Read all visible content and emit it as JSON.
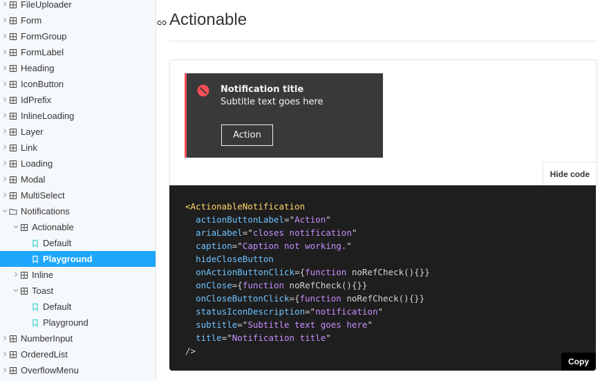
{
  "sidebar": {
    "items": [
      {
        "label": "FileUploader",
        "depth": 0,
        "type": "component",
        "caret": "right"
      },
      {
        "label": "Form",
        "depth": 0,
        "type": "component",
        "caret": "right"
      },
      {
        "label": "FormGroup",
        "depth": 0,
        "type": "component",
        "caret": "right"
      },
      {
        "label": "FormLabel",
        "depth": 0,
        "type": "component",
        "caret": "right"
      },
      {
        "label": "Heading",
        "depth": 0,
        "type": "component",
        "caret": "right"
      },
      {
        "label": "IconButton",
        "depth": 0,
        "type": "component",
        "caret": "right"
      },
      {
        "label": "IdPrefix",
        "depth": 0,
        "type": "component",
        "caret": "right"
      },
      {
        "label": "InlineLoading",
        "depth": 0,
        "type": "component",
        "caret": "right"
      },
      {
        "label": "Layer",
        "depth": 0,
        "type": "component",
        "caret": "right"
      },
      {
        "label": "Link",
        "depth": 0,
        "type": "component",
        "caret": "right"
      },
      {
        "label": "Loading",
        "depth": 0,
        "type": "component",
        "caret": "right"
      },
      {
        "label": "Modal",
        "depth": 0,
        "type": "component",
        "caret": "right"
      },
      {
        "label": "MultiSelect",
        "depth": 0,
        "type": "component",
        "caret": "right"
      },
      {
        "label": "Notifications",
        "depth": 0,
        "type": "folder",
        "caret": "down"
      },
      {
        "label": "Actionable",
        "depth": 1,
        "type": "component",
        "caret": "down"
      },
      {
        "label": "Default",
        "depth": 2,
        "type": "story",
        "caret": ""
      },
      {
        "label": "Playground",
        "depth": 2,
        "type": "story",
        "caret": "",
        "selected": true
      },
      {
        "label": "Inline",
        "depth": 1,
        "type": "component",
        "caret": "right"
      },
      {
        "label": "Toast",
        "depth": 1,
        "type": "component",
        "caret": "down"
      },
      {
        "label": "Default",
        "depth": 2,
        "type": "story",
        "caret": ""
      },
      {
        "label": "Playground",
        "depth": 2,
        "type": "story",
        "caret": ""
      },
      {
        "label": "NumberInput",
        "depth": 0,
        "type": "component",
        "caret": "right"
      },
      {
        "label": "OrderedList",
        "depth": 0,
        "type": "component",
        "caret": "right"
      },
      {
        "label": "OverflowMenu",
        "depth": 0,
        "type": "component",
        "caret": "right"
      }
    ],
    "icon_names": {
      "component": "component-grid-icon",
      "folder": "folder-icon",
      "story": "bookmark-icon"
    }
  },
  "main": {
    "title": "Actionable",
    "anchor_icon": "link-icon",
    "notification": {
      "title": "Notification title",
      "subtitle": "Subtitle text goes here",
      "action_label": "Action",
      "status_icon": "error-filled-icon"
    },
    "hide_code_label": "Hide code",
    "copy_label": "Copy",
    "code_lines": [
      [
        [
          "tag",
          "<ActionableNotification"
        ]
      ],
      [
        [
          "plain",
          "  "
        ],
        [
          "attr",
          "actionButtonLabel"
        ],
        [
          "plain",
          "=\""
        ],
        [
          "str",
          "Action"
        ],
        [
          "plain",
          "\""
        ]
      ],
      [
        [
          "plain",
          "  "
        ],
        [
          "attr",
          "ariaLabel"
        ],
        [
          "plain",
          "=\""
        ],
        [
          "str",
          "closes notification"
        ],
        [
          "plain",
          "\""
        ]
      ],
      [
        [
          "plain",
          "  "
        ],
        [
          "attr",
          "caption"
        ],
        [
          "plain",
          "=\""
        ],
        [
          "str",
          "Caption not working."
        ],
        [
          "plain",
          "\""
        ]
      ],
      [
        [
          "plain",
          "  "
        ],
        [
          "attr",
          "hideCloseButton"
        ]
      ],
      [
        [
          "plain",
          "  "
        ],
        [
          "attr",
          "onActionButtonClick"
        ],
        [
          "plain",
          "={"
        ],
        [
          "kw",
          "function"
        ],
        [
          "plain",
          " noRefCheck(){}}"
        ]
      ],
      [
        [
          "plain",
          "  "
        ],
        [
          "attr",
          "onClose"
        ],
        [
          "plain",
          "={"
        ],
        [
          "kw",
          "function"
        ],
        [
          "plain",
          " noRefCheck(){}}"
        ]
      ],
      [
        [
          "plain",
          "  "
        ],
        [
          "attr",
          "onCloseButtonClick"
        ],
        [
          "plain",
          "={"
        ],
        [
          "kw",
          "function"
        ],
        [
          "plain",
          " noRefCheck(){}}"
        ]
      ],
      [
        [
          "plain",
          "  "
        ],
        [
          "attr",
          "statusIconDescription"
        ],
        [
          "plain",
          "=\""
        ],
        [
          "str",
          "notification"
        ],
        [
          "plain",
          "\""
        ]
      ],
      [
        [
          "plain",
          "  "
        ],
        [
          "attr",
          "subtitle"
        ],
        [
          "plain",
          "=\""
        ],
        [
          "str",
          "Subtitle text goes here"
        ],
        [
          "plain",
          "\""
        ]
      ],
      [
        [
          "plain",
          "  "
        ],
        [
          "attr",
          "title"
        ],
        [
          "plain",
          "=\""
        ],
        [
          "str",
          "Notification title"
        ],
        [
          "plain",
          "\""
        ]
      ],
      [
        [
          "plain",
          "/>"
        ]
      ]
    ]
  },
  "colors": {
    "sidebar_bg": "#f6f9fc",
    "selected_bg": "#1ea7fd",
    "story_icon": "#37d5d3",
    "notification_bg": "#393939",
    "notification_accent": "#fa4d56",
    "code_bg": "#1e1e1e"
  }
}
